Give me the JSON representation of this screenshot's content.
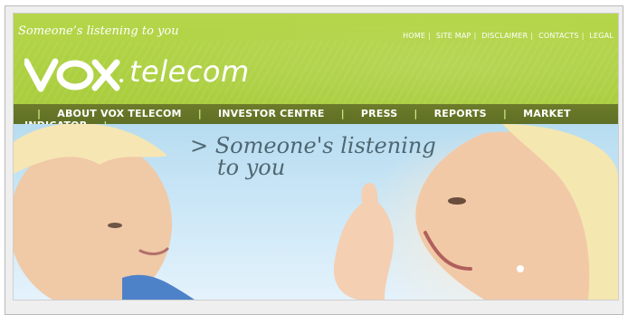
{
  "header": {
    "tagline": "Someone’s listening to you",
    "top_links": [
      "HOME",
      "SITE MAP",
      "DISCLAIMER",
      "CONTACTS",
      "LEGAL"
    ],
    "logo": {
      "mark_text": "VOX",
      "word": "telecom"
    },
    "colors": {
      "header_green": "#aed144",
      "nav_olive": "#667727",
      "text_white": "#ffffff"
    }
  },
  "nav": {
    "items": [
      "ABOUT VOX TELECOM",
      "INVESTOR CENTRE",
      "PRESS",
      "REPORTS",
      "MARKET INDICATOR"
    ]
  },
  "hero": {
    "line1": "> Someone's listening",
    "line2": "to you"
  }
}
